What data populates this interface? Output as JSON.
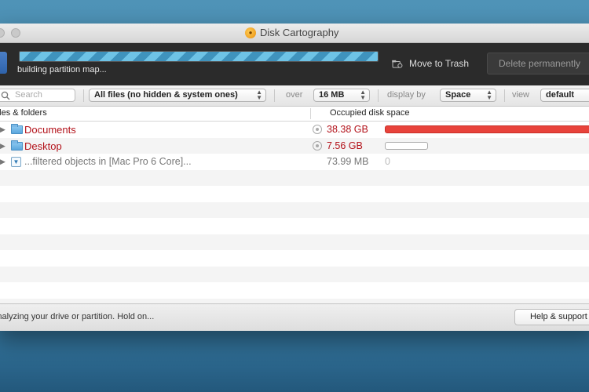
{
  "window": {
    "title": "Disk Cartography",
    "app_icon": "magnifier-icon"
  },
  "toolbar": {
    "progress_fraction": 1.0,
    "status": "building partition map...",
    "move_to_trash_label": "Move to Trash",
    "move_to_trash_icon": "trash-icon",
    "delete_label": "Delete permanently"
  },
  "filterbar": {
    "search_placeholder": "Search",
    "filter_select": "All files (no hidden & system ones)",
    "over_label": "over",
    "size_select": "16 MB",
    "display_by_label": "display by",
    "display_select": "Space",
    "view_label": "view",
    "view_select": "default"
  },
  "columns": {
    "files": "Files & folders",
    "space": "Occupied disk space"
  },
  "rows": [
    {
      "name": "Documents",
      "size": "38.38 GB",
      "icon": "folder-icon",
      "share": 1.0,
      "bar_color": "#e8433b"
    },
    {
      "name": "Desktop",
      "size": "7.56 GB",
      "icon": "folder-icon",
      "share": 0.197,
      "bar_color": "#ffffff"
    },
    {
      "name": "...filtered objects in [Mac Pro 6 Core]...",
      "size": "73.99 MB",
      "icon": "filter-icon",
      "value": "0"
    }
  ],
  "statusbar": {
    "message": "Analyzing your drive or partition. Hold on...",
    "help_label": "Help & support"
  },
  "colors": {
    "accent_blue": "#3f93bd",
    "large_item_red": "#b3121a",
    "toolbar_dark": "#2b2b2b"
  }
}
